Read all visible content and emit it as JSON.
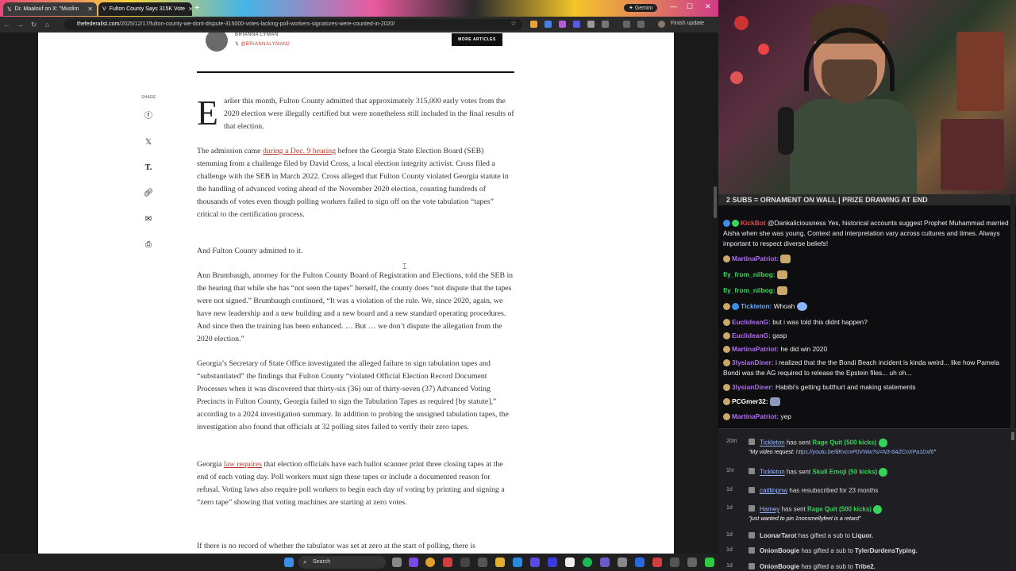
{
  "browser": {
    "tabs": [
      {
        "label": "Dr. Maalouf on X: \"Muslim",
        "active": false
      },
      {
        "label": "Fulton County Says 315K Vote",
        "active": true
      }
    ],
    "gemini_label": "Gemini",
    "url_host": "thefederalist.com",
    "url_path": "/2025/12/17/fulton-county-we-dont-dispute-315000-votes-lacking-poll-workers-signatures-were-counted-in-2020/",
    "finish_update": "Finish update"
  },
  "article": {
    "author_name": "BRIANNA LYMAN",
    "author_handle": "@BRIANNALYMAN2",
    "more_articles": "MORE ARTICLES",
    "share_label": "SHARE",
    "share_icons": [
      "facebook-icon",
      "twitter-icon",
      "truth-social-icon",
      "link-icon",
      "email-icon",
      "print-icon"
    ],
    "dropcap": "E",
    "p1": "arlier this month, Fulton County admitted that approximately 315,000 early votes from the 2020 election were illegally certified but were nonetheless still included in the final results of that election.",
    "p2_a": "The admission came ",
    "p2_link": "during a Dec. 9 hearing",
    "p2_b": " before the Georgia State Election Board (SEB) stemming from a challenge filed by David Cross, a local election integrity activist. Cross filed a challenge with the SEB in March 2022. Cross alleged that Fulton County violated Georgia statute in the handling of advanced voting ahead of the November 2020 election, counting hundreds of thousands of votes even though polling workers failed to sign off on the vote tabulation “tapes” critical to the certification process.",
    "p3": "And Fulton County admitted to it.",
    "p4": "Ann Brumbaugh, attorney for the Fulton County Board of Registration and Elections, told the SEB in the hearing that while she has “not seen the tapes” herself, the county does “not dispute that the tapes were not signed.” Brumbaugh continued, “It was a violation of the rule. We, since 2020, again, we have new leadership and a new building and a new board and a new standard operating procedures. And since then the training has been enhanced. … But … we don’t dispute the allegation from the 2020 election.”",
    "p5": "Georgia’s Secretary of State Office investigated the alleged failure to sign tabulation tapes and “substantiated” the findings that Fulton County “violated Official Election Record Document Processes when it was discovered that thirty-six (36) out of thirty-seven (37) Advanced Voting Precincts in Fulton County, Georgia failed to sign the Tabulation Tapes as required [by statute],” according to a 2024 investigation summary. In addition to probing the unsigned tabulation tapes, the investigation also found that officials at 32 polling sites failed to verify their zero tapes.",
    "p6_a": "Georgia ",
    "p6_link": "law requires",
    "p6_b": " that election officials have each ballot scanner print three closing tapes at the end of each voting day. Poll workers must sign these tapes or include a documented reason for refusal. Voting laws also require poll workers to begin each day of voting by printing and signing a “zero tape” showing that voting machines are starting at zero votes.",
    "p7": "If there is no record of whether the tabulator was set at zero at the start of polling, there is"
  },
  "taskbar": {
    "search_label": "Search"
  },
  "stream": {
    "banner": "2 SUBS = ORNAMENT ON WALL | PRIZE DRAWING AT END",
    "chat": [
      {
        "user": "KickBot",
        "color": "#e24a4a",
        "text": "@Dankaliciousness Yes, historical accounts suggest Prophet Muhammad married Aisha when she was young. Context and interpretation vary across cultures and times. Always important to respect diverse beliefs!"
      },
      {
        "user": "MartinaPatriot:",
        "color": "#b06cf0",
        "text": ""
      },
      {
        "user": "fly_from_nilbog:",
        "color": "#3ad45a",
        "text": ""
      },
      {
        "user": "fly_from_nilbog:",
        "color": "#3ad45a",
        "text": ""
      },
      {
        "user": "Tickleton:",
        "color": "#6aa8ff",
        "text": "Whoah"
      },
      {
        "user": "EuclideanG:",
        "color": "#b06cf0",
        "text": "but i was told this didnt happen?"
      },
      {
        "user": "EuclideanG:",
        "color": "#b06cf0",
        "text": "gasp"
      },
      {
        "user": "MartinaPatriot:",
        "color": "#b06cf0",
        "text": "he did win 2020"
      },
      {
        "user": "3lysianDiner:",
        "color": "#b06cf0",
        "text": "i realized that the the Bondi Beach incident is kinda weird... like how Pamela Bondi was the AG required to release the Epstein files... uh oh..."
      },
      {
        "user": "3lysianDiner:",
        "color": "#b06cf0",
        "text": "Habibi's getting butthurt and making statements"
      },
      {
        "user": "PCGmer32:",
        "color": "#ffffff",
        "text": ""
      },
      {
        "user": "MartinaPatriot:",
        "color": "#b06cf0",
        "text": "yep"
      }
    ],
    "events": [
      {
        "time": "20m",
        "user": "Tickleton",
        "mid": " has sent ",
        "gift": "Rage Quit (500 kicks)",
        "sub_prefix": "\"My video request: ",
        "sub_link": "https://youtu.be/8KvcrxP0VWw?si=N3-6AZCnXPa1Dxf6",
        "sub_suffix": "\""
      },
      {
        "time": "1hr",
        "user": "Tickleton",
        "mid": " has sent ",
        "gift": "Skull Emoji (50 kicks)"
      },
      {
        "time": "1d",
        "user": "caitlinpnw",
        "mid": " has resubscribed for 23 months",
        "gift": ""
      },
      {
        "time": "1d",
        "user": "Hamey",
        "mid": " has sent ",
        "gift": "Rage Quit (500 kicks)",
        "sub_prefix": "\"just wanted to pin 1nonsmellyfeet is a retard\"",
        "sub_link": "",
        "sub_suffix": ""
      },
      {
        "time": "1d",
        "user": "LoonarTarot",
        "mid": " has gifted a sub to ",
        "gift": "Liquor."
      },
      {
        "time": "1d",
        "user": "OnionBoogie",
        "mid": " has gifted a sub to ",
        "gift": "TylerDurdensTyping."
      },
      {
        "time": "1d",
        "user": "OnionBoogie",
        "mid": " has gifted a sub to ",
        "gift": "Tribe2."
      }
    ]
  }
}
